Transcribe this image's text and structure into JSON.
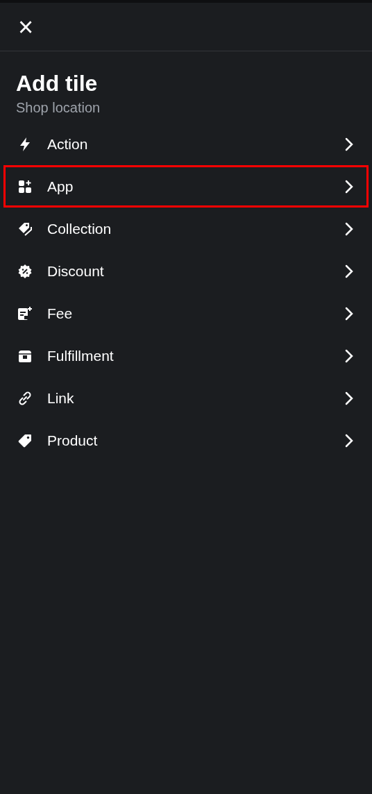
{
  "header": {
    "close": "×"
  },
  "title": "Add tile",
  "subtitle": "Shop location",
  "items": [
    {
      "label": "Action",
      "selected": false
    },
    {
      "label": "App",
      "selected": true
    },
    {
      "label": "Collection",
      "selected": false
    },
    {
      "label": "Discount",
      "selected": false
    },
    {
      "label": "Fee",
      "selected": false
    },
    {
      "label": "Fulfillment",
      "selected": false
    },
    {
      "label": "Link",
      "selected": false
    },
    {
      "label": "Product",
      "selected": false
    }
  ]
}
